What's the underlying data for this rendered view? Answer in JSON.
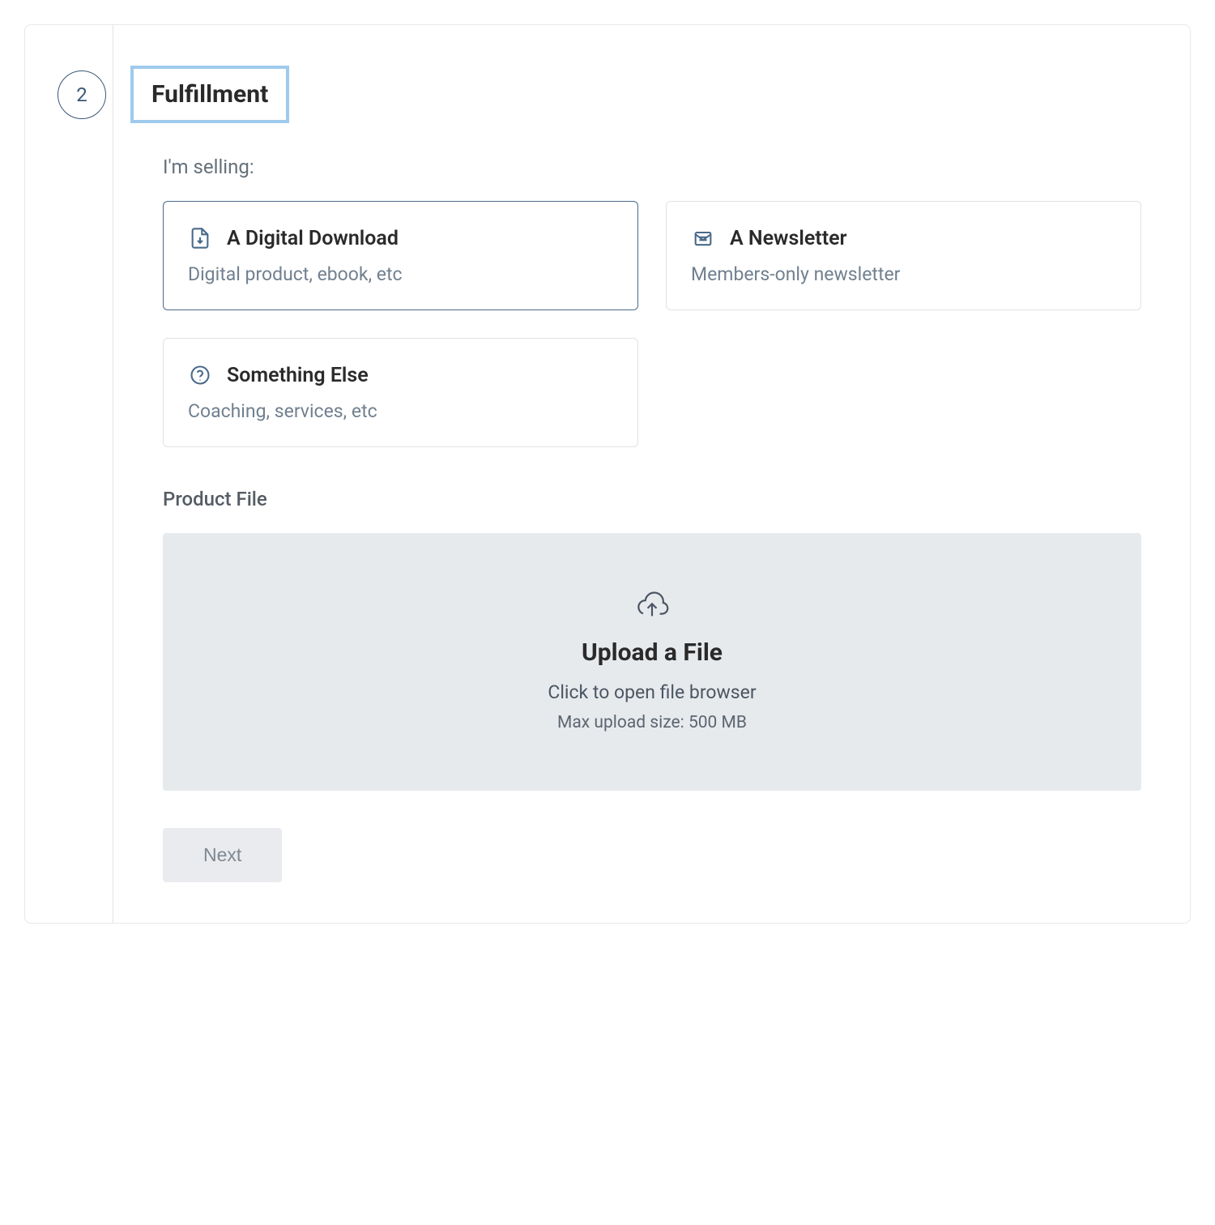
{
  "step": {
    "number": "2",
    "title": "Fulfillment"
  },
  "selling": {
    "label": "I'm selling:",
    "options": [
      {
        "title": "A Digital Download",
        "desc": "Digital product, ebook, etc",
        "selected": true
      },
      {
        "title": "A Newsletter",
        "desc": "Members-only newsletter",
        "selected": false
      },
      {
        "title": "Something Else",
        "desc": "Coaching, services, etc",
        "selected": false
      }
    ]
  },
  "product_file": {
    "heading": "Product File",
    "upload_title": "Upload a File",
    "upload_sub": "Click to open file browser",
    "upload_hint": "Max upload size: 500 MB"
  },
  "footer": {
    "next_label": "Next"
  }
}
